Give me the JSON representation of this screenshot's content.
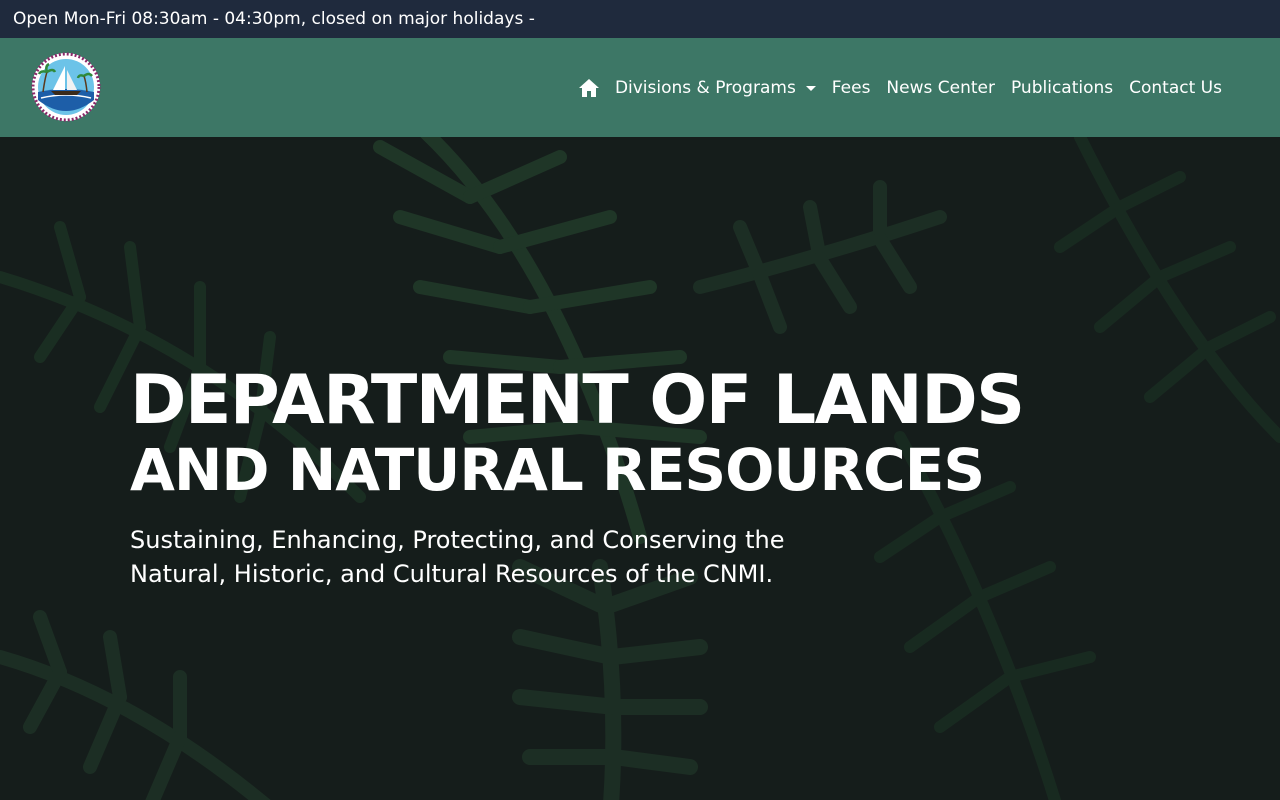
{
  "topbar": {
    "hours_text": "Open Mon-Fri 08:30am - 04:30pm, closed on major holidays -"
  },
  "navbar": {
    "logo_icon": "dlnr-seal-icon",
    "home_icon": "home-icon",
    "items": [
      {
        "label": "Divisions & Programs",
        "has_dropdown": true
      },
      {
        "label": "Fees"
      },
      {
        "label": "News Center"
      },
      {
        "label": "Publications"
      },
      {
        "label": "Contact Us"
      }
    ]
  },
  "hero": {
    "title_line1": "DEPARTMENT OF LANDS",
    "title_line2": "AND NATURAL RESOURCES",
    "subtitle": "Sustaining, Enhancing, Protecting, and Conserving the Natural, Historic, and Cultural Resources of the CNMI."
  },
  "colors": {
    "topbar_bg": "#1f2a3d",
    "navbar_bg": "#3d7766",
    "hero_bg": "#18201e",
    "leaf_green": "#2f5a3c",
    "text": "#ffffff"
  }
}
